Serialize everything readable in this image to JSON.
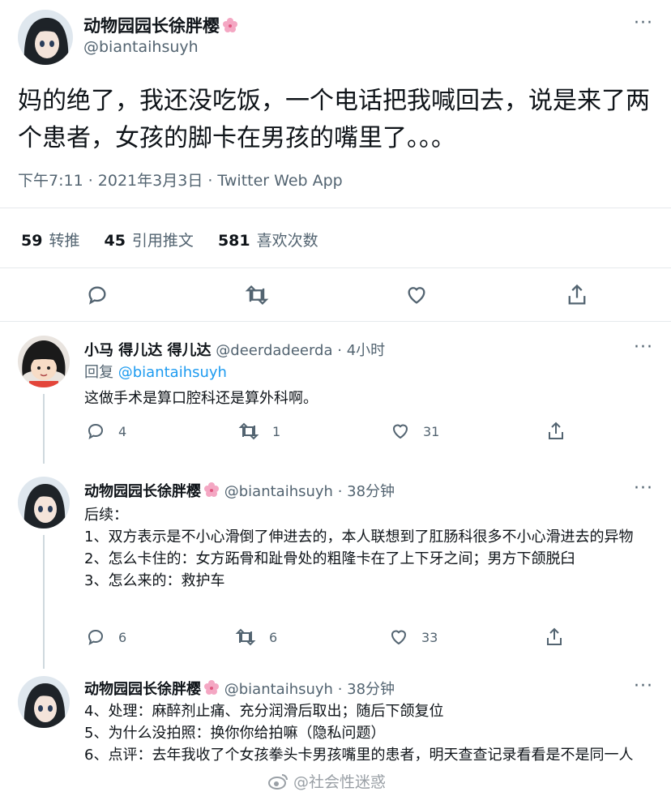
{
  "main": {
    "name": "动物园园长徐胖樱",
    "handle": "@biantaihsuyh",
    "text": "妈的绝了，我还没吃饭，一个电话把我喊回去，说是来了两个患者，女孩的脚卡在男孩的嘴里了。。。",
    "meta": "下午7:11 · 2021年3月3日 · Twitter Web App",
    "stats": [
      {
        "count": "59",
        "label": "转推"
      },
      {
        "count": "45",
        "label": "引用推文"
      },
      {
        "count": "581",
        "label": "喜欢次数"
      }
    ]
  },
  "replies": [
    {
      "name": "小马 得儿达 得儿达",
      "handle": "@deerdadeerda",
      "time": "· 4小时",
      "reply_prefix": "回复",
      "reply_to": "@biantaihsuyh",
      "lines": [
        "这做手术是算口腔科还是算外科啊。"
      ],
      "reply_count": "4",
      "retweet_count": "1",
      "like_count": "31"
    },
    {
      "name": "动物园园长徐胖樱",
      "handle": "@biantaihsuyh",
      "time": "· 38分钟",
      "lines": [
        "后续：",
        "1、双方表示是不小心滑倒了伸进去的，本人联想到了肛肠科很多不小心滑进去的异物",
        "2、怎么卡住的：女方跖骨和趾骨处的粗隆卡在了上下牙之间；男方下颌脱臼",
        "3、怎么来的：救护车"
      ],
      "reply_count": "6",
      "retweet_count": "6",
      "like_count": "33"
    },
    {
      "name": "动物园园长徐胖樱",
      "handle": "@biantaihsuyh",
      "time": "· 38分钟",
      "lines": [
        "4、处理：麻醉剂止痛、充分润滑后取出；随后下颌复位",
        "5、为什么没拍照：换你你给拍嘛（隐私问题）",
        "6、点评：去年我收了个女孩拳头卡男孩嘴里的患者，明天查查记录看看是不是同一人"
      ]
    }
  ],
  "more_glyph": "···",
  "watermark": "@社会性迷惑",
  "colors": {
    "accent": "#1d9bf0",
    "muted": "#536471",
    "text": "#0f1419"
  }
}
